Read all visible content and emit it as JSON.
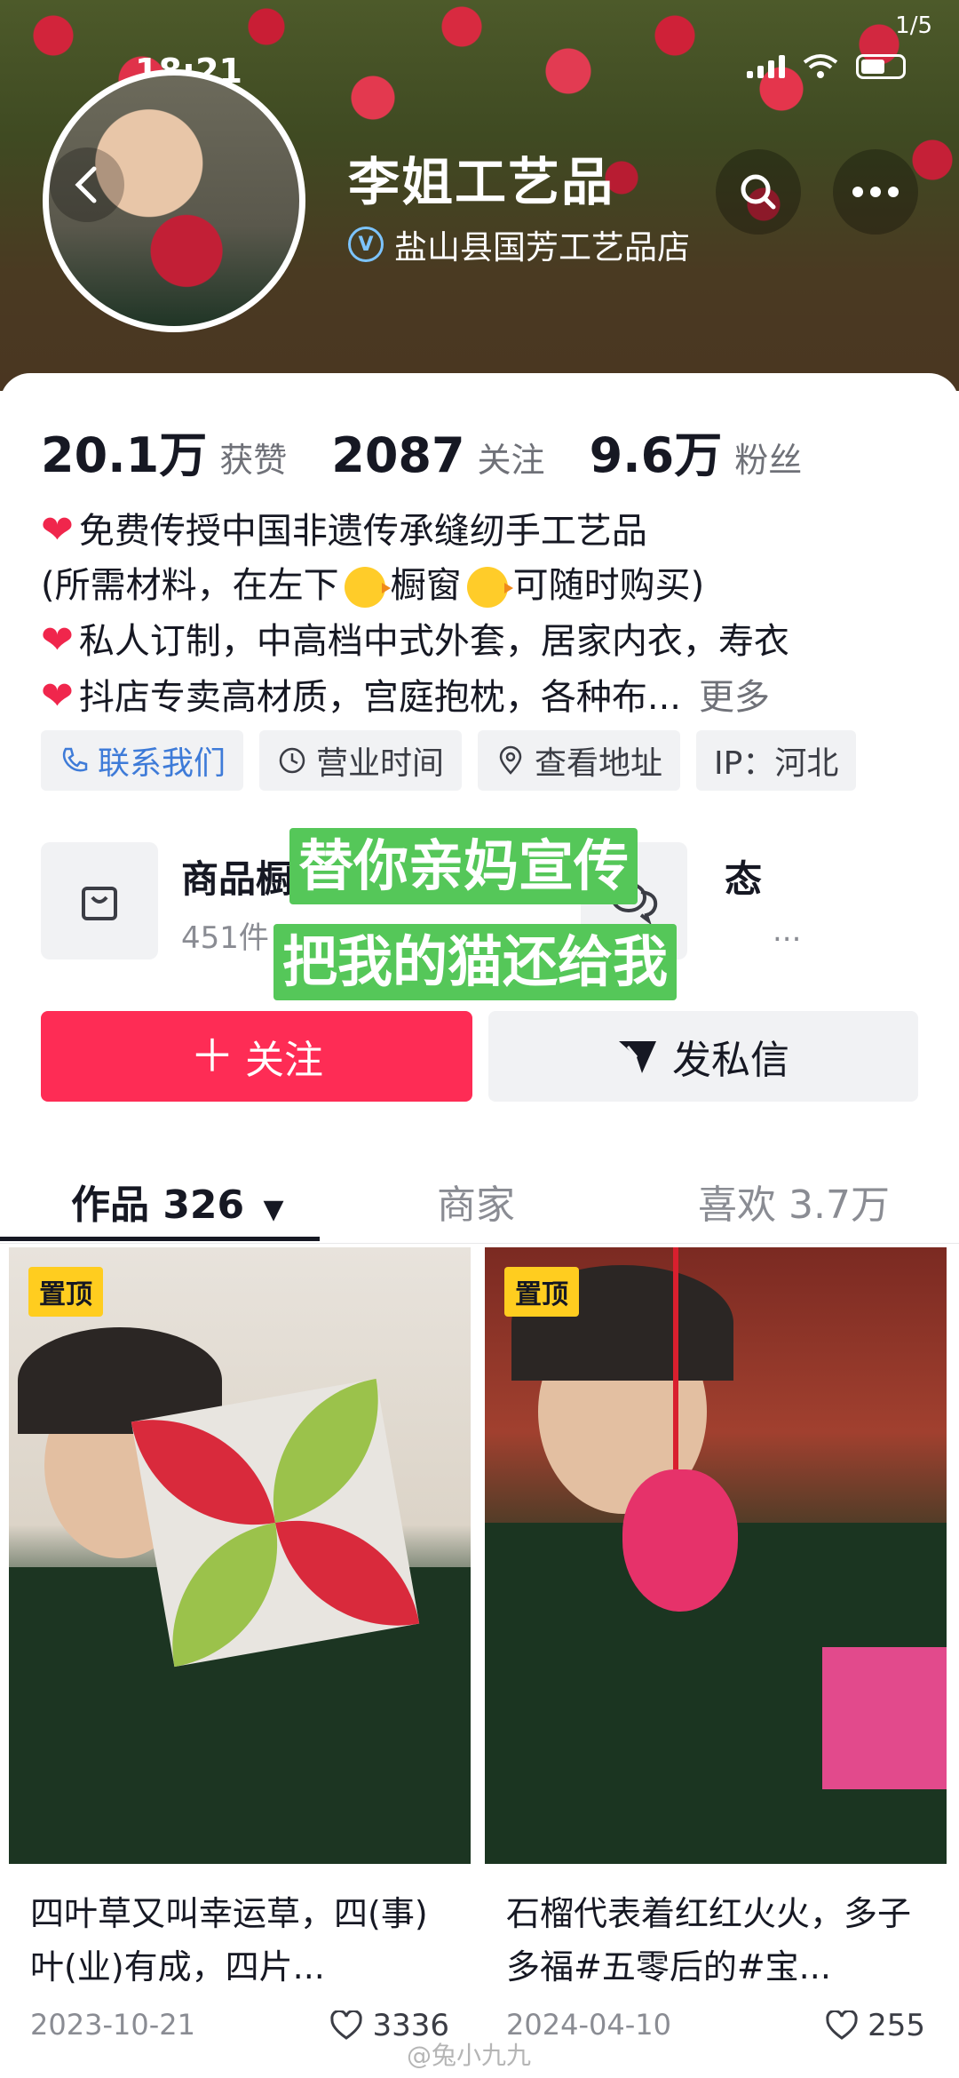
{
  "status_bar": {
    "time": "18:21",
    "page_counter": "1/5"
  },
  "header": {
    "name": "李姐工艺品",
    "verified_store": "盐山县国芳工艺品店"
  },
  "stats": [
    {
      "value": "20.1万",
      "label": "获赞"
    },
    {
      "value": "2087",
      "label": "关注"
    },
    {
      "value": "9.6万",
      "label": "粉丝"
    }
  ],
  "bio": {
    "line1": "免费传授中国非遗传承缝纫手工艺品",
    "line2_a": "(所需材料，在左下",
    "line2_b": "橱窗",
    "line2_c": "可随时购买)",
    "line3": "私人订制，中高档中式外套，居家内衣，寿衣",
    "line4": "抖店专卖高材质，宫庭抱枕，各种布...",
    "more": "更多"
  },
  "tags": {
    "contact": "联系我们",
    "hours": "营业时间",
    "address": "查看地址",
    "ip": "IP：河北"
  },
  "shop": {
    "title": "商品橱",
    "subtitle": "451件",
    "right_title": "态",
    "right_sub": "..."
  },
  "overlay": {
    "line1": "替你亲妈宣传",
    "line2": "把我的猫还给我"
  },
  "actions": {
    "follow": "关注",
    "message": "发私信"
  },
  "tabs": {
    "works": "作品 326",
    "merchant": "商家",
    "likes": "喜欢 3.7万"
  },
  "videos": [
    {
      "pinned": "置顶",
      "title": "四叶草又叫幸运草，四(事)叶(业)有成，四片...",
      "date": "2023-10-21",
      "likes": "3336"
    },
    {
      "pinned": "置顶",
      "title": "石榴代表着红红火火，多子多福#五零后的#宝...",
      "date": "2024-04-10",
      "likes": "255"
    }
  ],
  "watermark": "@兔小九九",
  "colors": {
    "primary": "#fe2c55",
    "pin": "#ffcd1f",
    "overlay": "#55c759",
    "link": "#3e7bd8"
  }
}
